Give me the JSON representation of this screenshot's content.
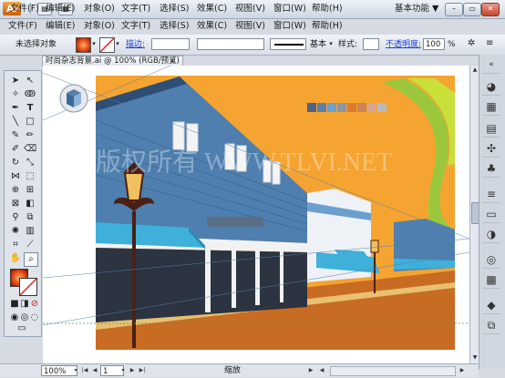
{
  "app": {
    "logo": "Ai",
    "workspace_label": "基本功能",
    "workspace_arrow": "▼"
  },
  "menus": [
    "文件(F)",
    "编辑(E)",
    "对象(O)",
    "文字(T)",
    "选择(S)",
    "效果(C)",
    "视图(V)",
    "窗口(W)",
    "帮助(H)"
  ],
  "controlbar": {
    "selection_status": "未选择对象",
    "stroke_label": "描边:",
    "brush_label": "基本",
    "style_label": "样式:",
    "opacity_label": "不透明度:",
    "opacity_value": "100",
    "opacity_unit": "%"
  },
  "document": {
    "tab_title": "时尚杂志背景.ai @ 100% (RGB/预览)",
    "tab_close": "×"
  },
  "status": {
    "zoom": "100%",
    "page": "1",
    "status_text": "缩放"
  },
  "colors": {
    "sky": "#f5a431",
    "ground": "#c86b23",
    "building_blue": "#4e7fae",
    "awning": "#3eb0d9",
    "palette": [
      "#4a6387",
      "#5a7fa8",
      "#6b9fd0",
      "#8a95a8",
      "#d97a2c",
      "#c98658",
      "#d8a58a",
      "#b8b9bf"
    ]
  },
  "watermark": "版权所有 WWW.TLVI.NET"
}
